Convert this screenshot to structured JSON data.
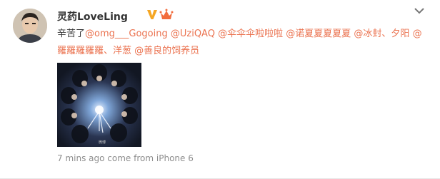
{
  "post": {
    "username": "灵药LoveLing",
    "verified_icon": "verified-v-icon",
    "vip_icon": "vip-crown-icon",
    "menu_icon": "chevron-down-icon",
    "text_prefix": "辛苦了",
    "mentions": [
      "@omg___Gogoing",
      "@UziQAQ",
      "@伞伞伞啦啦啦",
      "@诺夏夏夏夏夏",
      "@冰封、夕阳",
      "@羅羅羅羅羅、洋葱",
      "@善良的饲养员"
    ],
    "photo_watermark": "微博",
    "timestamp": "7 mins ago",
    "source_prefix": "come from",
    "source": "iPhone 6"
  },
  "colors": {
    "link": "#eb7350",
    "verified": "#f5a623",
    "meta": "#8e8e8e"
  }
}
